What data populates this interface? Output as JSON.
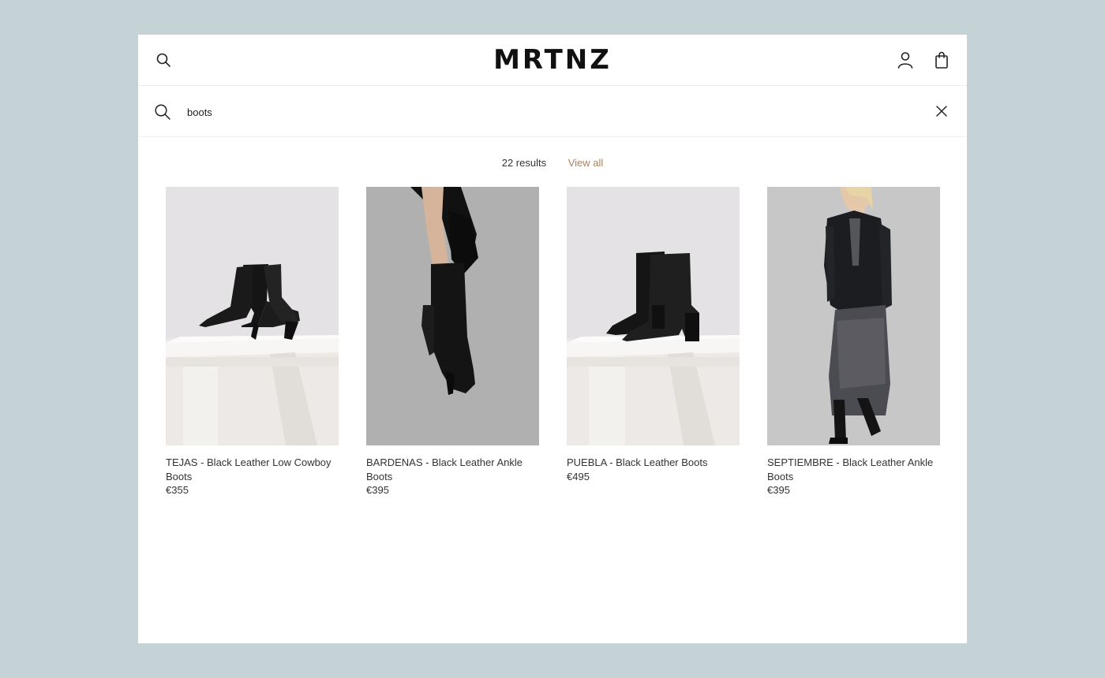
{
  "header": {
    "logo": "MRTNZ"
  },
  "search": {
    "query": "boots"
  },
  "results": {
    "count_label": "22 results",
    "view_all_label": "View all"
  },
  "products": [
    {
      "name": "TEJAS - Black Leather Low Cowboy Boots",
      "price": "€355"
    },
    {
      "name": "BARDENAS - Black Leather Ankle Boots",
      "price": "€395"
    },
    {
      "name": "PUEBLA - Black Leather Boots",
      "price": "€495"
    },
    {
      "name": "SEPTIEMBRE - Black Leather Ankle Boots",
      "price": "€395"
    }
  ],
  "colors": {
    "backdrop": "#c6d3d6",
    "accent": "#a8825e",
    "text": "#333333"
  },
  "icons": [
    "search-icon",
    "account-icon",
    "shopping-bag-icon",
    "close-icon"
  ]
}
